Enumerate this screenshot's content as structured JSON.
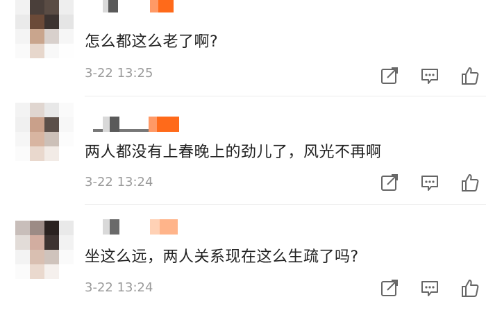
{
  "comments": [
    {
      "text": "怎么都这么老了啊?",
      "time": "3-22 13:25"
    },
    {
      "text": "两人都没有上春晚上的劲儿了，风光不再啊",
      "time": "3-22 13:24"
    },
    {
      "text": "坐这么远，两人关系现在这么生疏了吗?",
      "time": "3-22 13:24"
    }
  ],
  "icons": {
    "share": "share-icon",
    "reply": "comment-icon",
    "like": "thumbs-up-icon"
  }
}
